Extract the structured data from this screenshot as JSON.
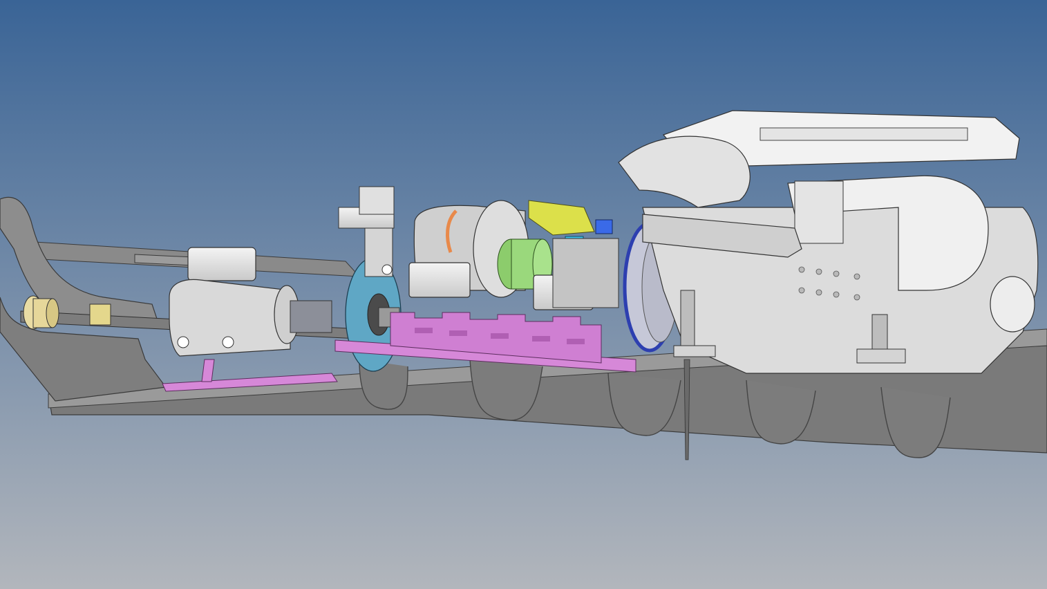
{
  "viewport": {
    "background_top": "#3a6496",
    "background_bottom": "#b2b6bc"
  },
  "colors": {
    "steel_grey": "#8c8c8c",
    "frame_dark": "#6f6f6f",
    "engine_white": "#e9e9e9",
    "bracket_magenta": "#d688d8",
    "flange_blue": "#5fa7c5",
    "housing_green": "#9ad87c",
    "mount_yellow": "#dce04a",
    "coupling_cream": "#e9dca4",
    "band_orange": "#e8894a",
    "flywheel_blue": "#2d3fb0",
    "part_cyan": "#3fc1e9",
    "part_blue": "#3a6ae8"
  }
}
